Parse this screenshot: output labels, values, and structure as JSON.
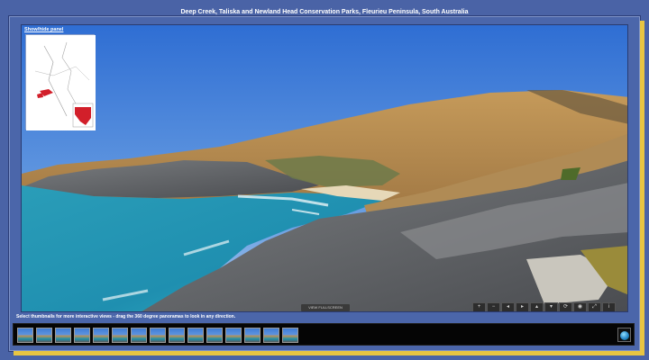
{
  "page": {
    "title": "Deep Creek, Taliska and Newland Head Conservation Parks, Fleurieu Peninsula, South Australia",
    "instructions": "Select thumbnails for more interactive views - drag the 360 degree panoramas to look in any direction."
  },
  "viewer": {
    "showhide_label": "Show/hide panel",
    "fullscreen_label": "VIEW FULLSCREEN",
    "controls": [
      {
        "icon": "zoom-in-icon",
        "glyph": "+"
      },
      {
        "icon": "zoom-out-icon",
        "glyph": "−"
      },
      {
        "icon": "arrow-left-icon",
        "glyph": "◂"
      },
      {
        "icon": "arrow-right-icon",
        "glyph": "▸"
      },
      {
        "icon": "arrow-up-icon",
        "glyph": "▴"
      },
      {
        "icon": "arrow-down-icon",
        "glyph": "▾"
      },
      {
        "icon": "autorotate-icon",
        "glyph": "⟳"
      },
      {
        "icon": "hotspots-icon",
        "glyph": "◉"
      },
      {
        "icon": "fullscreen-icon",
        "glyph": "⤢"
      },
      {
        "icon": "info-icon",
        "glyph": "i"
      }
    ]
  },
  "thumbnails": {
    "count": 15
  },
  "colors": {
    "page_bg": "#4a63a6",
    "frame_shadow": "#e8c542",
    "thumbstrip_bg": "#050505"
  }
}
